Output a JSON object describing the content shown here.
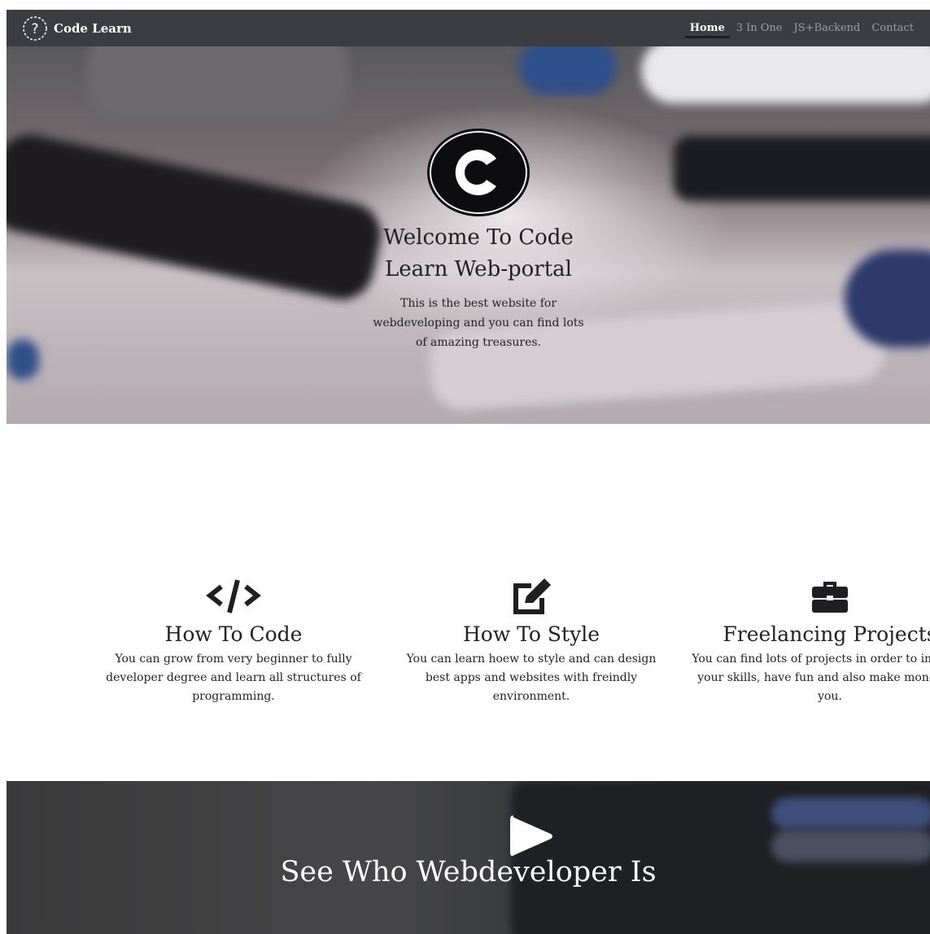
{
  "navbar": {
    "brand_text": "Code Learn",
    "brand_icon": "question-circle-icon",
    "links": [
      {
        "label": "Home",
        "active": true
      },
      {
        "label": "3 In One",
        "active": false
      },
      {
        "label": "JS+Backend",
        "active": false
      },
      {
        "label": "Contact",
        "active": false
      }
    ]
  },
  "hero": {
    "logo_icon": "c-logo-icon",
    "title": "Welcome To Code Learn Web-portal",
    "description": "This is the best website for webdeveloping and you can find lots of amazing treasures."
  },
  "features": [
    {
      "icon": "code-icon",
      "title": "How To Code",
      "description": "You can grow from very beginner to fully developer degree and learn all structures of programming."
    },
    {
      "icon": "edit-icon",
      "title": "How To Style",
      "description": "You can learn hoew to style and can design best apps and websites with freindly environment."
    },
    {
      "icon": "briefcase-icon",
      "title": "Freelancing Projects",
      "description": "You can find lots of projects in order to improve your skills, have fun and also make money for you."
    }
  ],
  "video": {
    "play_icon": "play-icon",
    "title": "See Who Webdeveloper Is"
  },
  "colors": {
    "navbar_bg": "#3b3d42",
    "nav_inactive": "#9b9ea3",
    "nav_active": "#ffffff",
    "text_dark": "#222222"
  }
}
